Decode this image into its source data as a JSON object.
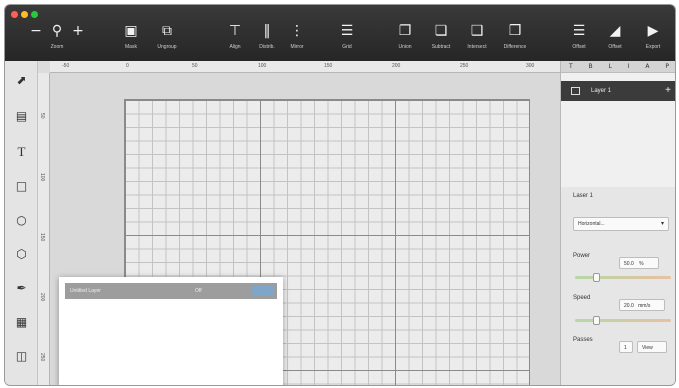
{
  "window": {
    "traffic_colors": [
      "#ff5f57",
      "#febc2e",
      "#28c840"
    ]
  },
  "toolbar": {
    "zoom": {
      "minus": "−",
      "plus": "+",
      "label": "Zoom"
    },
    "buttons": [
      {
        "label": "Mask",
        "icon": "mask-icon"
      },
      {
        "label": "Ungroup",
        "icon": "ungroup-icon"
      },
      {
        "label": "Align",
        "icon": "align-icon"
      },
      {
        "label": "Distrib.",
        "icon": "distribute-icon"
      },
      {
        "label": "Mirror",
        "icon": "mirror-icon"
      },
      {
        "label": "Grid",
        "icon": "grid-icon"
      },
      {
        "label": "Union",
        "icon": "union-icon"
      },
      {
        "label": "Subtract",
        "icon": "subtract-icon"
      },
      {
        "label": "Intersect",
        "icon": "intersect-icon"
      },
      {
        "label": "Difference",
        "icon": "difference-icon"
      },
      {
        "label": "Offset",
        "icon": "offset-icon"
      },
      {
        "label": "Offset",
        "icon": "offset-icon"
      },
      {
        "label": "Export",
        "icon": "export-icon"
      }
    ]
  },
  "rulers": {
    "top_labels": [
      "-50",
      "0",
      "50",
      "100",
      "150",
      "200",
      "250",
      "300"
    ],
    "left_labels": [
      "50",
      "100",
      "150",
      "200",
      "250"
    ]
  },
  "tools": [
    "select-tool-icon",
    "image-tool-icon",
    "text-tool-icon",
    "rectangle-tool-icon",
    "ellipse-tool-icon",
    "polygon-tool-icon",
    "pen-tool-icon",
    "grid-tool-icon",
    "array-tool-icon"
  ],
  "float_panel": {
    "col1": "Untitled Layer",
    "col2": "Off"
  },
  "right_panel": {
    "tab_icons": [
      "T",
      "B",
      "L",
      "I",
      "A",
      "P"
    ],
    "layer_name": "Layer 1",
    "layer_add": "+",
    "section_title": "Laser 1",
    "mode_value": "Horizontal...",
    "power_label": "Power",
    "power_value": "50.0",
    "power_unit": "%",
    "power_level": 0.2,
    "speed_label": "Speed",
    "speed_value": "20.0",
    "speed_unit": "mm/s",
    "speed_level": 0.2,
    "passes_label": "Passes",
    "passes_value": "1",
    "passes_btn": "View"
  }
}
